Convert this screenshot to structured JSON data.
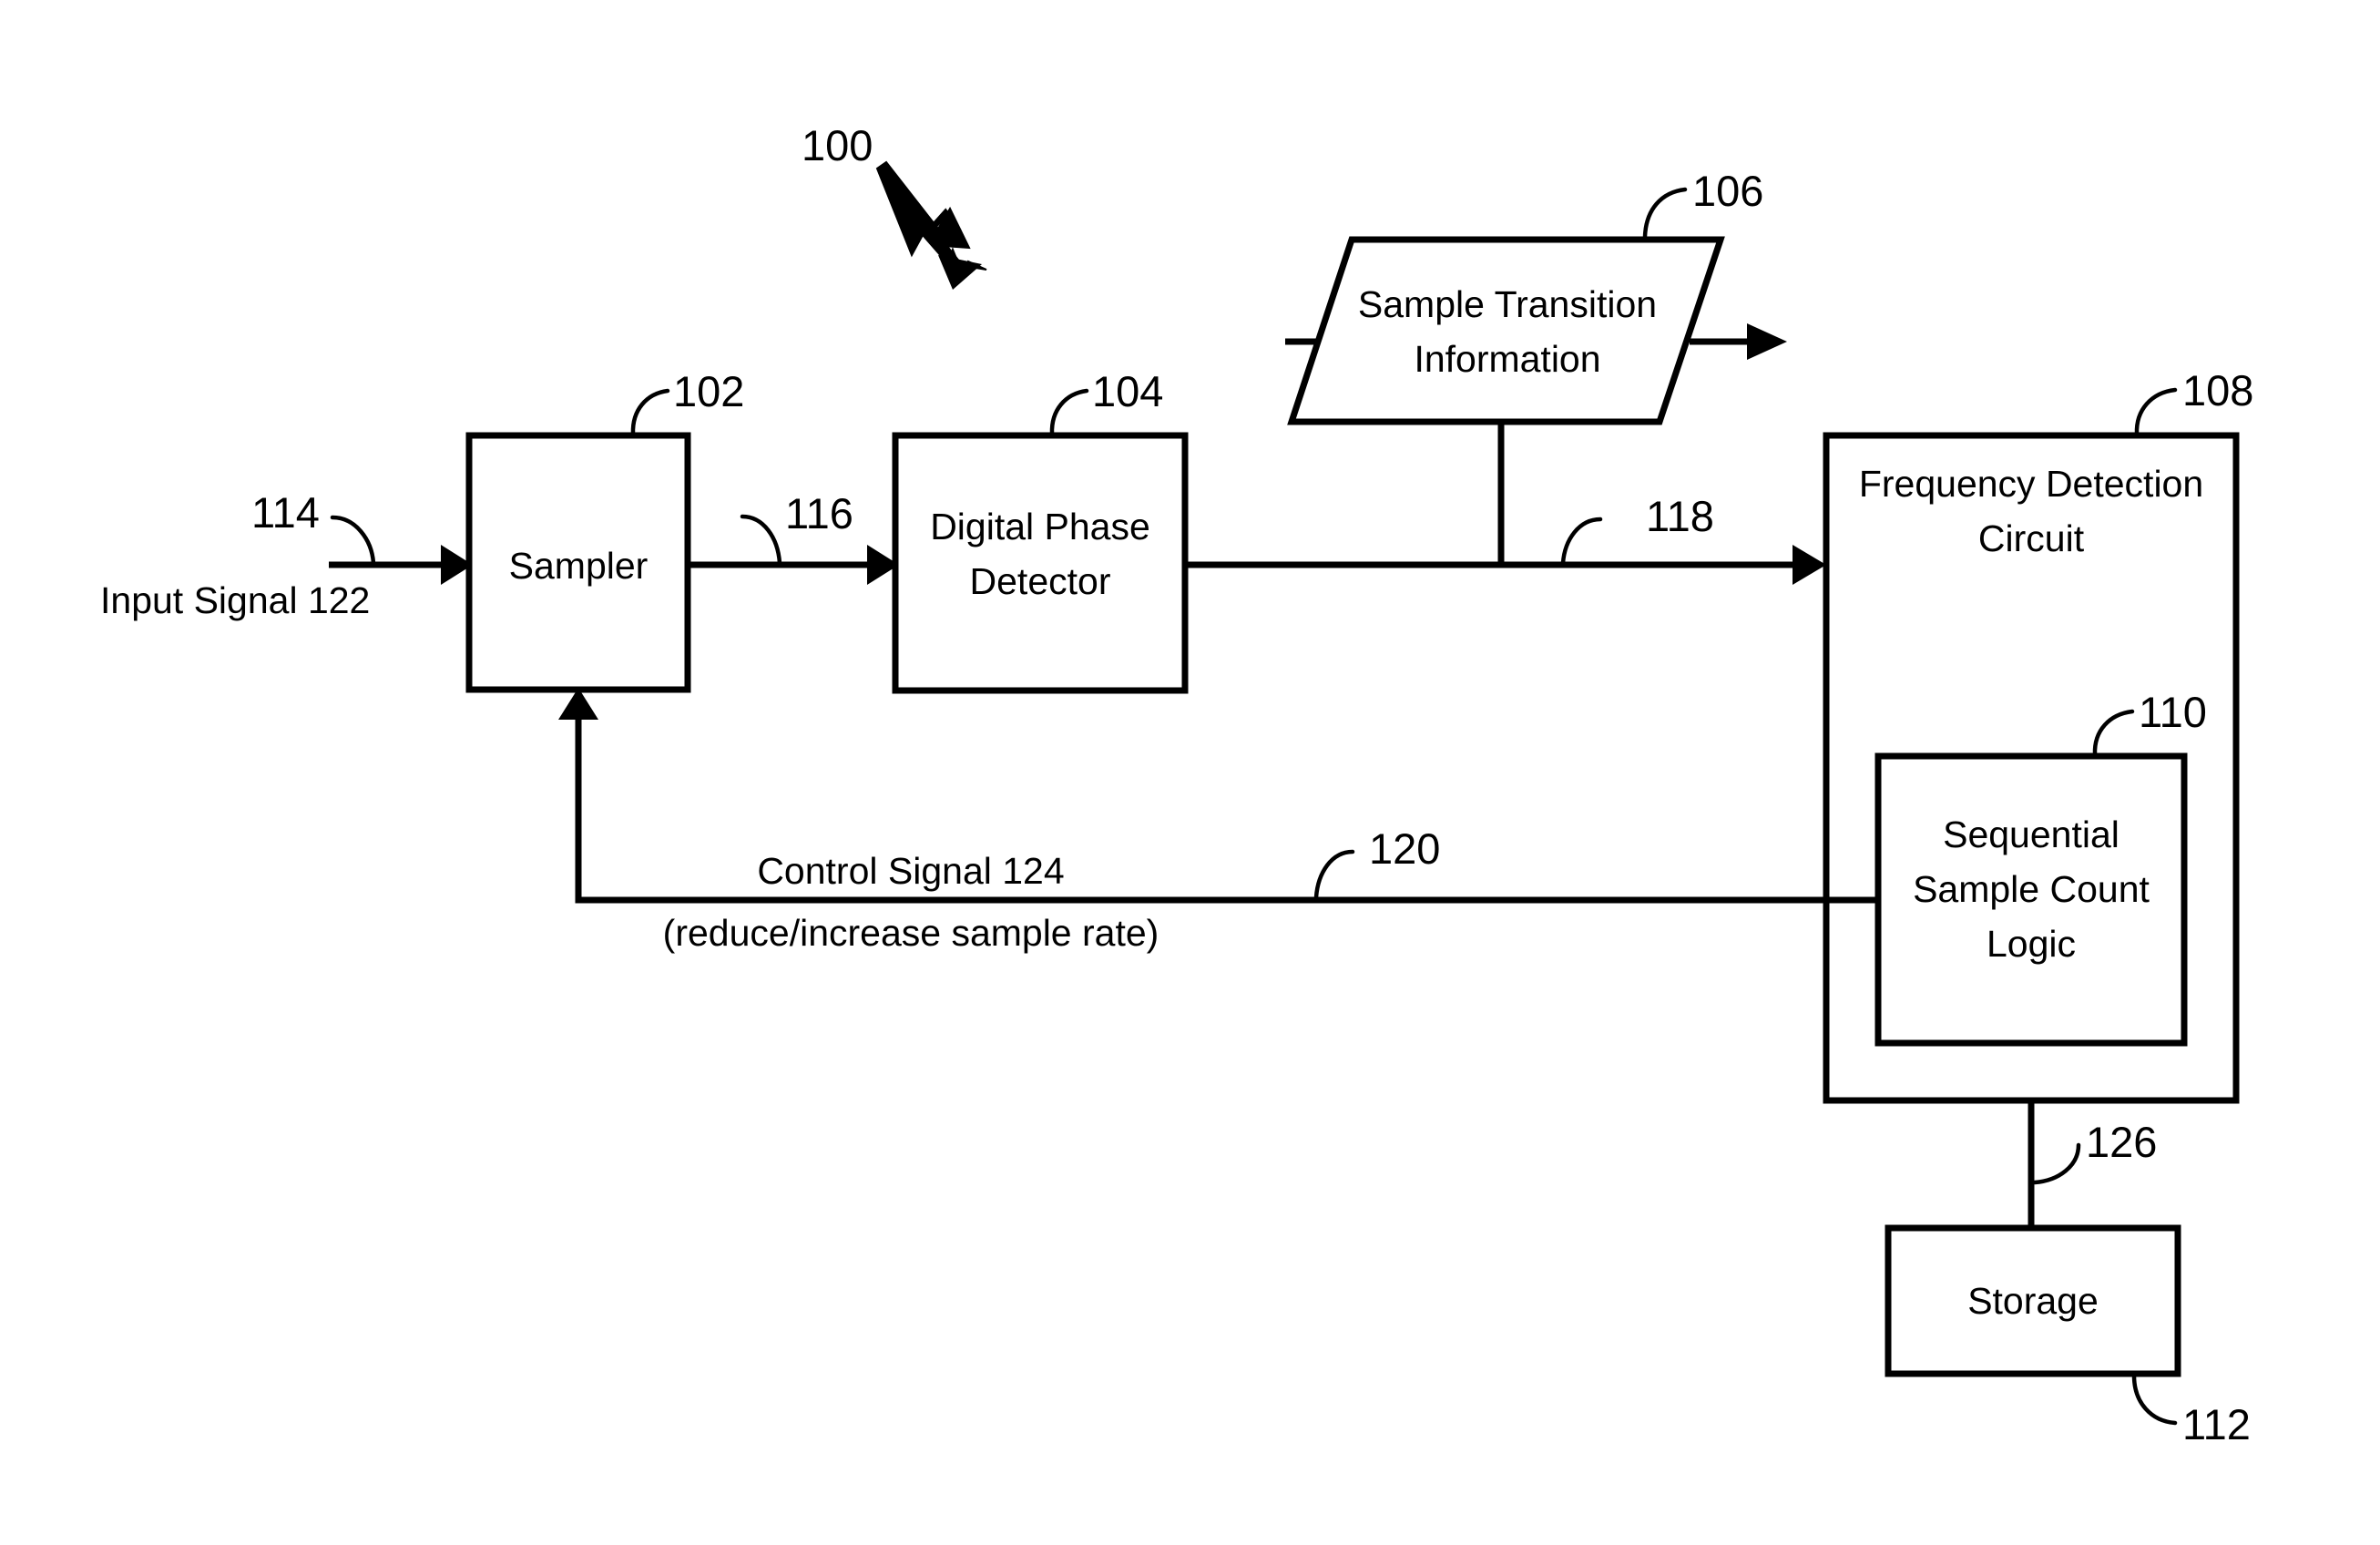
{
  "figure": {
    "title": "100",
    "type": "block-diagram",
    "background_color": "#ffffff",
    "line_color": "#000000"
  },
  "blocks": {
    "sampler": {
      "label": "Sampler",
      "ref": "102"
    },
    "digital_phase_detector": {
      "label_line1": "Digital Phase",
      "label_line2": "Detector",
      "ref": "104"
    },
    "sample_transition_information": {
      "label_line1": "Sample Transition",
      "label_line2": "Information",
      "ref": "106"
    },
    "frequency_detection_circuit": {
      "label_line1": "Frequency Detection",
      "label_line2": "Circuit",
      "ref": "108"
    },
    "sequential_sample_count_logic": {
      "label_line1": "Sequential",
      "label_line2": "Sample Count",
      "label_line3": "Logic",
      "ref": "110"
    },
    "storage": {
      "label": "Storage",
      "ref": "112"
    }
  },
  "signals": {
    "input_signal": {
      "label": "Input Signal 122",
      "ref": "114"
    },
    "sampler_to_detector": {
      "ref": "116"
    },
    "detector_to_frequency": {
      "ref": "118"
    },
    "feedback_path": {
      "ref": "120"
    },
    "control_signal": {
      "label_line1": "Control Signal 124",
      "label_line2": "(reduce/increase sample rate)"
    },
    "storage_link": {
      "ref": "126"
    }
  }
}
